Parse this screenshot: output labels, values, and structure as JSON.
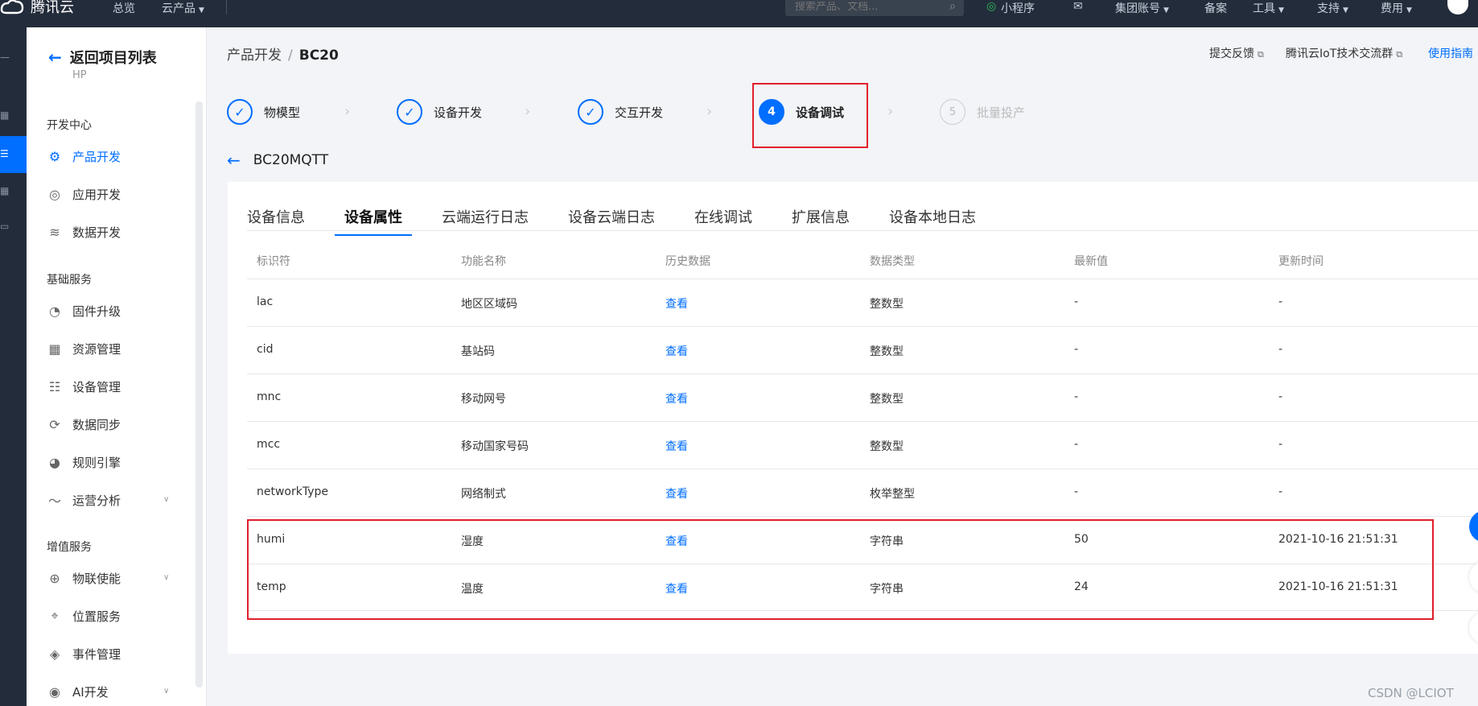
{
  "topbar": {
    "logo_text": "腾讯云",
    "nav": [
      "总览",
      "云产品"
    ],
    "search_placeholder": "搜索产品、文档...",
    "right_items": [
      "小程序",
      "集团账号",
      "备案",
      "工具",
      "支持",
      "费用"
    ]
  },
  "sidebar": {
    "back_label": "返回项目列表",
    "project_name": "HP",
    "groups": [
      "开发中心",
      "基础服务",
      "增值服务"
    ],
    "items": [
      {
        "label": "产品开发",
        "icon": "chip-icon"
      },
      {
        "label": "应用开发",
        "icon": "app-icon"
      },
      {
        "label": "数据开发",
        "icon": "flow-icon"
      },
      {
        "label": "固件升级",
        "icon": "upgrade-icon"
      },
      {
        "label": "资源管理",
        "icon": "grid-icon"
      },
      {
        "label": "设备管理",
        "icon": "list-icon"
      },
      {
        "label": "数据同步",
        "icon": "sync-icon"
      },
      {
        "label": "规则引擎",
        "icon": "rule-icon"
      },
      {
        "label": "运营分析",
        "icon": "pulse-icon"
      },
      {
        "label": "物联使能",
        "icon": "globe-icon"
      },
      {
        "label": "位置服务",
        "icon": "location-icon"
      },
      {
        "label": "事件管理",
        "icon": "event-icon"
      },
      {
        "label": "AI开发",
        "icon": "ai-icon"
      }
    ]
  },
  "breadcrumb": {
    "parent": "产品开发",
    "current": "BC20"
  },
  "header_links": [
    "提交反馈",
    "腾讯云IoT技术交流群",
    "使用指南"
  ],
  "steps": [
    {
      "label": "物模型"
    },
    {
      "label": "设备开发"
    },
    {
      "label": "交互开发"
    },
    {
      "label": "设备调试",
      "number": "4"
    },
    {
      "label": "批量投产",
      "number": "5"
    }
  ],
  "device_name": "BC20MQTT",
  "tabs": [
    "设备信息",
    "设备属性",
    "云端运行日志",
    "设备云端日志",
    "在线调试",
    "扩展信息",
    "设备本地日志"
  ],
  "table": {
    "columns": [
      "标识符",
      "功能名称",
      "历史数据",
      "数据类型",
      "最新值",
      "更新时间"
    ],
    "rows": [
      [
        "lac",
        "地区区域码",
        "查看",
        "整数型",
        "-",
        "-"
      ],
      [
        "cid",
        "基站码",
        "查看",
        "整数型",
        "-",
        "-"
      ],
      [
        "mnc",
        "移动网号",
        "查看",
        "整数型",
        "-",
        "-"
      ],
      [
        "mcc",
        "移动国家号码",
        "查看",
        "整数型",
        "-",
        "-"
      ],
      [
        "networkType",
        "网络制式",
        "查看",
        "枚举整型",
        "-",
        "-"
      ],
      [
        "humi",
        "湿度",
        "查看",
        "字符串",
        "50",
        "2021-10-16 21:51:31"
      ],
      [
        "temp",
        "温度",
        "查看",
        "字符串",
        "24",
        "2021-10-16 21:51:31"
      ]
    ]
  },
  "watermark": "CSDN @LCIOT",
  "colors": {
    "accent": "#006eff",
    "topbar": "#232c3b",
    "highlight": "#e0202c"
  }
}
